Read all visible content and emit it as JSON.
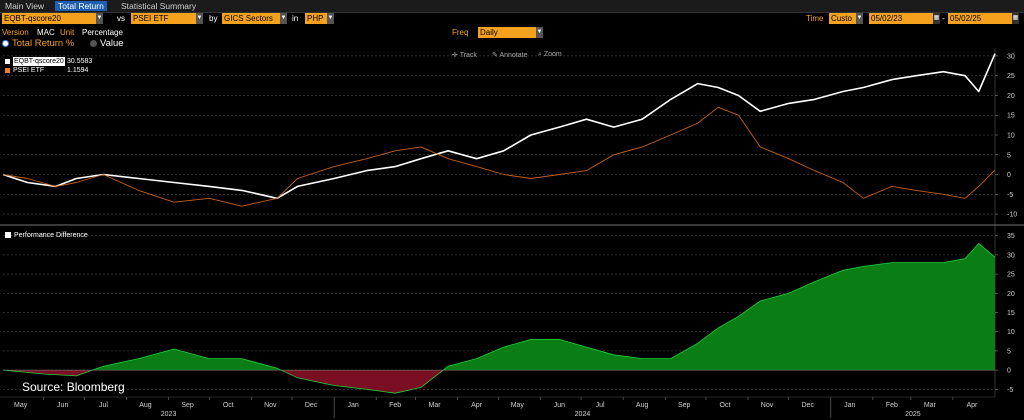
{
  "tabs": [
    {
      "label": "Main View",
      "active": false
    },
    {
      "label": "Total Return",
      "active": true
    },
    {
      "label": "Statistical Summary",
      "active": false
    }
  ],
  "controls": {
    "security": "EQBT-qscore20",
    "vs_label": "vs",
    "benchmark": "PSEI ETF",
    "by_label": "by",
    "grouping": "GICS Sectors",
    "in_label": "in",
    "currency": "PHP",
    "time_label": "Time",
    "time_mode": "Custo",
    "start_date": "05/02/23",
    "end_date": "05/02/25",
    "version_label": "Version",
    "version_value": "MAC",
    "unit_label": "Unit",
    "unit_value": "Percentage",
    "freq_label": "Freq",
    "freq_value": "Daily"
  },
  "view_options": [
    {
      "label": "Total Return %",
      "selected": true
    },
    {
      "label": "Value",
      "selected": false
    }
  ],
  "toolbar": {
    "track": "Track",
    "annotate": "Annotate",
    "zoom": "Zoom"
  },
  "legend": [
    {
      "name": "EQBT-qscore20",
      "value": "30.5583",
      "color": "#ffffff"
    },
    {
      "name": "PSEI ETF",
      "value": "1.1594",
      "color": "#f07d1f"
    }
  ],
  "perf_legend": "Performance Difference",
  "source": "Source: Bloomberg",
  "colors": {
    "fund": "#ffffff",
    "benchmark": "#c4601a",
    "positive": "#0a7d14",
    "negative": "#7a0f24"
  },
  "chart_data": [
    {
      "type": "line",
      "ylim": [
        -12,
        32
      ],
      "yticks": [
        -10,
        -5,
        0,
        5,
        10,
        15,
        20,
        25,
        30
      ],
      "x_start": "2023-05-02",
      "x_end": "2025-05-02",
      "series": [
        {
          "name": "EQBT-qscore20",
          "x": [
            "2023-05-02",
            "2023-05-20",
            "2023-06-10",
            "2023-06-25",
            "2023-07-15",
            "2023-08-10",
            "2023-09-05",
            "2023-10-01",
            "2023-10-25",
            "2023-11-20",
            "2023-12-05",
            "2024-01-01",
            "2024-01-25",
            "2024-02-15",
            "2024-03-05",
            "2024-03-25",
            "2024-04-15",
            "2024-05-05",
            "2024-05-25",
            "2024-06-15",
            "2024-07-05",
            "2024-07-25",
            "2024-08-15",
            "2024-09-05",
            "2024-09-25",
            "2024-10-10",
            "2024-10-25",
            "2024-11-10",
            "2024-12-01",
            "2024-12-20",
            "2025-01-10",
            "2025-01-25",
            "2025-02-15",
            "2025-03-05",
            "2025-03-25",
            "2025-04-10",
            "2025-04-20",
            "2025-05-02"
          ],
          "values": [
            0,
            -2,
            -3,
            -1,
            0,
            -1,
            -2,
            -3,
            -4,
            -6,
            -3,
            -1,
            1,
            2,
            4,
            6,
            4,
            6,
            10,
            12,
            14,
            12,
            14,
            19,
            23,
            22,
            20,
            16,
            18,
            19,
            21,
            22,
            24,
            25,
            26,
            25,
            21,
            30.56
          ]
        },
        {
          "name": "PSEI ETF",
          "x": [
            "2023-05-02",
            "2023-05-20",
            "2023-06-10",
            "2023-06-25",
            "2023-07-15",
            "2023-08-10",
            "2023-09-05",
            "2023-10-01",
            "2023-10-25",
            "2023-11-20",
            "2023-12-05",
            "2024-01-01",
            "2024-01-25",
            "2024-02-15",
            "2024-03-05",
            "2024-03-25",
            "2024-04-15",
            "2024-05-05",
            "2024-05-25",
            "2024-06-15",
            "2024-07-05",
            "2024-07-25",
            "2024-08-15",
            "2024-09-05",
            "2024-09-25",
            "2024-10-10",
            "2024-10-25",
            "2024-11-10",
            "2024-12-01",
            "2024-12-20",
            "2025-01-10",
            "2025-01-25",
            "2025-02-15",
            "2025-03-05",
            "2025-03-25",
            "2025-04-10",
            "2025-04-20",
            "2025-05-02"
          ],
          "values": [
            0,
            -1,
            -3,
            -2,
            0,
            -4,
            -7,
            -6,
            -8,
            -6,
            -1,
            2,
            4,
            6,
            7,
            4,
            2,
            0,
            -1,
            0,
            1,
            5,
            7,
            10,
            13,
            17,
            15,
            7,
            4,
            1,
            -2,
            -6,
            -3,
            -4,
            -5,
            -6,
            -3,
            1.16
          ]
        }
      ]
    },
    {
      "type": "area",
      "ylim": [
        -7,
        37
      ],
      "yticks": [
        -5,
        0,
        5,
        10,
        15,
        20,
        25,
        30,
        35
      ],
      "x_start": "2023-05-02",
      "x_end": "2025-05-02",
      "series": [
        {
          "name": "Performance Difference",
          "x": [
            "2023-05-02",
            "2023-06-01",
            "2023-06-25",
            "2023-07-15",
            "2023-08-10",
            "2023-09-05",
            "2023-10-01",
            "2023-10-25",
            "2023-11-20",
            "2023-12-05",
            "2024-01-01",
            "2024-01-25",
            "2024-02-15",
            "2024-03-05",
            "2024-03-25",
            "2024-04-15",
            "2024-05-05",
            "2024-05-25",
            "2024-06-15",
            "2024-07-05",
            "2024-07-25",
            "2024-08-15",
            "2024-09-05",
            "2024-09-25",
            "2024-10-10",
            "2024-10-25",
            "2024-11-10",
            "2024-12-01",
            "2024-12-20",
            "2025-01-10",
            "2025-01-25",
            "2025-02-15",
            "2025-03-05",
            "2025-03-25",
            "2025-04-10",
            "2025-04-20",
            "2025-05-02"
          ],
          "values": [
            0,
            -1,
            -1.5,
            1,
            3,
            5.5,
            3,
            3,
            0.5,
            -2,
            -4,
            -5,
            -6,
            -4.5,
            1,
            3,
            6,
            8,
            8,
            6,
            4,
            3,
            3,
            7,
            11,
            14,
            18,
            20,
            23,
            26,
            27,
            28,
            28,
            28,
            29,
            33,
            29.4
          ]
        }
      ],
      "x_tick_labels": [
        "May",
        "Jun",
        "Jul",
        "Aug",
        "Sep",
        "Oct",
        "Nov",
        "Dec",
        "Jan",
        "Feb",
        "Mar",
        "Apr",
        "May",
        "Jun",
        "Jul",
        "Aug",
        "Sep",
        "Oct",
        "Nov",
        "Dec",
        "Jan",
        "Feb",
        "Mar",
        "Apr"
      ],
      "x_year_labels": [
        "2023",
        "2024",
        "2025"
      ]
    }
  ]
}
